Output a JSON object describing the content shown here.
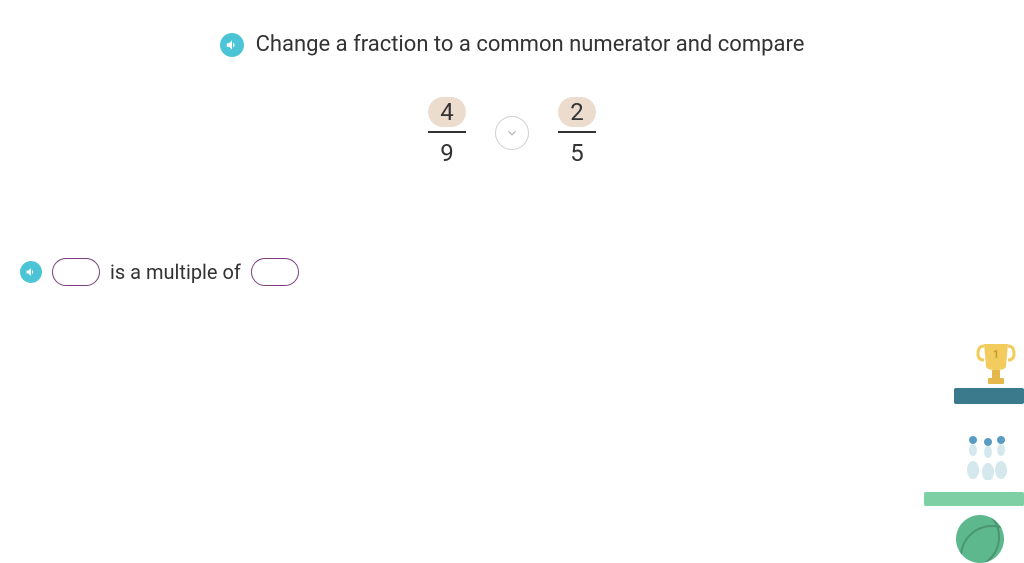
{
  "title": "Change a fraction to a common numerator and compare",
  "fraction1": {
    "numerator": "4",
    "denominator": "9"
  },
  "fraction2": {
    "numerator": "2",
    "denominator": "5"
  },
  "statement": {
    "middle_text": "is a multiple of"
  }
}
